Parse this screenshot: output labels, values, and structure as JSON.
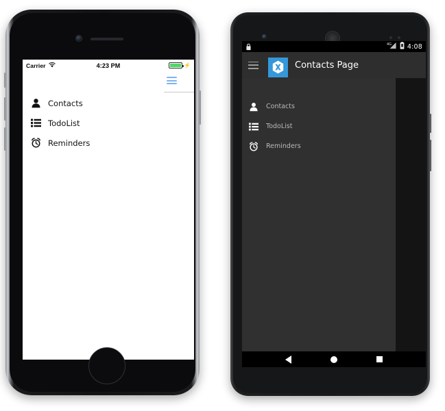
{
  "iphone": {
    "status_bar": {
      "carrier": "Carrier",
      "wifi_icon": "wifi-icon",
      "time": "4:23 PM",
      "battery_icon": "battery-full-icon",
      "charging_icon": "charging-bolt-icon",
      "battery_color": "#4cd964"
    },
    "navbar": {
      "hamburger_icon": "hamburger-menu-icon",
      "hamburger_color": "#7cb3f0"
    },
    "menu_items": [
      {
        "label": "Contacts",
        "icon": "person-icon"
      },
      {
        "label": "TodoList",
        "icon": "list-bullets-icon"
      },
      {
        "label": "Reminders",
        "icon": "alarm-clock-icon"
      }
    ]
  },
  "android": {
    "status_bar": {
      "lock_icon": "lock-icon",
      "signal_icon": "signal-4g-icon",
      "signal_label": "4G",
      "battery_icon": "battery-icon",
      "time": "4:08"
    },
    "toolbar": {
      "hamburger_icon": "hamburger-menu-icon",
      "logo_icon": "xamarin-logo-icon",
      "logo_color": "#3498db",
      "title": "Contacts Page",
      "background_color": "#2e2e2e"
    },
    "drawer": {
      "background_color": "#303030",
      "items": [
        {
          "label": "Contacts",
          "icon": "person-icon"
        },
        {
          "label": "TodoList",
          "icon": "list-bullets-icon"
        },
        {
          "label": "Reminders",
          "icon": "alarm-clock-icon"
        }
      ]
    },
    "nav_bar": {
      "back_icon": "back-triangle-icon",
      "home_icon": "home-circle-icon",
      "recents_icon": "recents-square-icon"
    }
  }
}
